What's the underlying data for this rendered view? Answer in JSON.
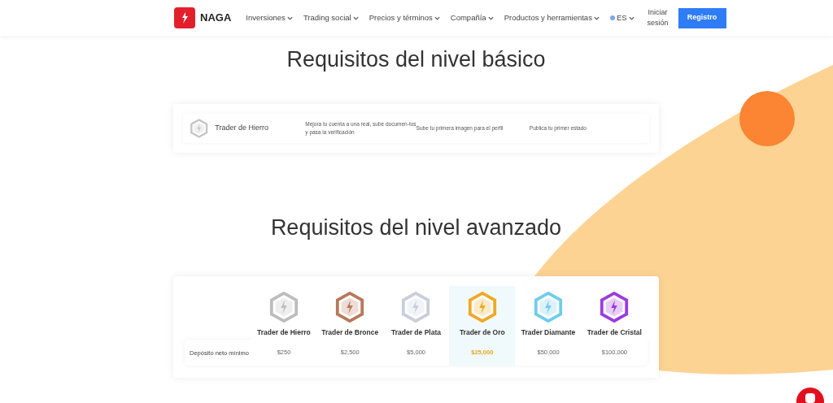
{
  "nav": {
    "logo": "NAGA",
    "menu": [
      {
        "label": "Inversiones"
      },
      {
        "label": "Trading social"
      },
      {
        "label": "Precios y términos"
      },
      {
        "label": "Compañía"
      },
      {
        "label": "Productos y herramientas"
      }
    ],
    "language": "ES",
    "login": "Iniciar sesión",
    "register": "Registro"
  },
  "basic": {
    "title": "Requisitos del nivel básico",
    "tier": {
      "name": "Trader de Hierro",
      "color": "#c4c4c4"
    },
    "requirements": [
      "Mejora tu cuenta a una real, sube documen-tos y pasa la verificación",
      "Sube tu primera imagen para el perfil",
      "Publica tu primer estado"
    ]
  },
  "advanced": {
    "title": "Requisitos del nivel avanzado",
    "row_label": "Depósito neto mínimo",
    "tiers": [
      {
        "name": "Trader de Hierro",
        "color": "#bdbdbd",
        "deposit": "$250",
        "selected": false
      },
      {
        "name": "Trader de Bronce",
        "color": "#b9785a",
        "deposit": "$2,500",
        "selected": false
      },
      {
        "name": "Trader de Plata",
        "color": "#c9cedb",
        "deposit": "$5,000",
        "selected": false
      },
      {
        "name": "Trader de Oro",
        "color": "#f0a825",
        "deposit": "$25,000",
        "selected": true
      },
      {
        "name": "Trader Diamante",
        "color": "#6fcdec",
        "deposit": "$50,000",
        "selected": false
      },
      {
        "name": "Trader de Cristal",
        "color": "#9b3be0",
        "deposit": "$100,000",
        "selected": false
      }
    ]
  }
}
